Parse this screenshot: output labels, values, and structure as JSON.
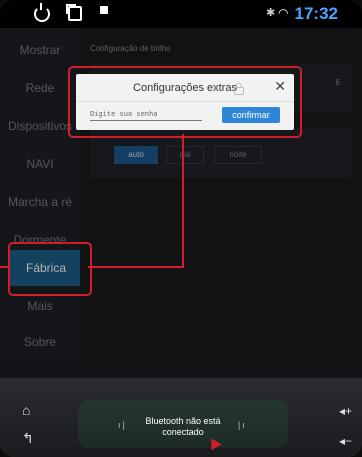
{
  "statusbar": {
    "time": "17:32",
    "wifi_icon": "wifi-icon",
    "bluetooth_icon": "bluetooth-icon"
  },
  "sidebar": {
    "items": [
      {
        "label": "Mostrar"
      },
      {
        "label": "Rede"
      },
      {
        "label": "Dispositivos"
      },
      {
        "label": "NAVI"
      },
      {
        "label": "Marcha a ré"
      },
      {
        "label": "Dormente"
      },
      {
        "label": "Fábrica",
        "active": true
      },
      {
        "label": "Mais"
      },
      {
        "label": "Sobre"
      }
    ]
  },
  "content": {
    "section_title": "Configuração de brilho",
    "slider_end": "6",
    "modes": [
      {
        "label": "auto",
        "selected": true
      },
      {
        "label": "dia"
      },
      {
        "label": "noite"
      }
    ]
  },
  "dialog": {
    "title": "Configurações extras",
    "password_placeholder": "Digite sua senha",
    "confirm_label": "confirmar"
  },
  "dock": {
    "bluetooth_line1": "Bluetooth não está",
    "bluetooth_line2": "conectado"
  },
  "colors": {
    "accent": "#2f86d6",
    "highlight": "#d01f2a",
    "time": "#4aa3ff"
  }
}
